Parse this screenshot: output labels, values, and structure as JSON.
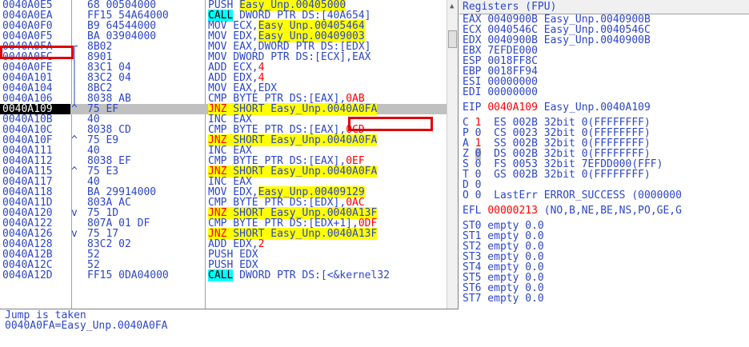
{
  "disasm": {
    "rows": [
      {
        "addr": "0040A0E5",
        "arrow": "",
        "hex": "68 00504000",
        "cmd": [
          {
            "t": "PUSH ",
            "s": ""
          },
          {
            "t": "Easy_Unp.00405000",
            "s": "hl"
          }
        ]
      },
      {
        "addr": "0040A0EA",
        "arrow": "",
        "hex": "FF15 54A64000",
        "cmd": [
          {
            "t": "CALL",
            "s": "call"
          },
          {
            "t": " DWORD PTR DS:[40A654]",
            "s": ""
          }
        ]
      },
      {
        "addr": "0040A0F0",
        "arrow": "",
        "hex": "B9 64544000",
        "cmd": [
          {
            "t": "MOV ECX,",
            "s": ""
          },
          {
            "t": "Easy_Unp.00405464",
            "s": "hl"
          }
        ]
      },
      {
        "addr": "0040A0F5",
        "arrow": "",
        "hex": "BA 03904000",
        "cmd": [
          {
            "t": "MOV EDX,",
            "s": ""
          },
          {
            "t": "Easy_Unp.00409003",
            "s": "hl"
          }
        ]
      },
      {
        "addr": "0040A0FA",
        "arrow": "┌",
        "hex": "8B02",
        "cmd": [
          {
            "t": "MOV EAX,DWORD PTR DS:[EDX]",
            "s": ""
          }
        ]
      },
      {
        "addr": "0040A0FC",
        "arrow": "│",
        "hex": "8901",
        "cmd": [
          {
            "t": "MOV DWORD PTR DS:[ECX],EAX",
            "s": ""
          }
        ]
      },
      {
        "addr": "0040A0FE",
        "arrow": "│",
        "hex": "83C1 04",
        "cmd": [
          {
            "t": "ADD ECX,",
            "s": ""
          },
          {
            "t": "4",
            "s": "red"
          }
        ]
      },
      {
        "addr": "0040A101",
        "arrow": "│",
        "hex": "83C2 04",
        "cmd": [
          {
            "t": "ADD EDX,",
            "s": ""
          },
          {
            "t": "4",
            "s": "red"
          }
        ]
      },
      {
        "addr": "0040A104",
        "arrow": "│",
        "hex": "8BC2",
        "cmd": [
          {
            "t": "MOV EAX,EDX",
            "s": ""
          }
        ]
      },
      {
        "addr": "0040A106",
        "arrow": "│",
        "hex": "8038 AB",
        "cmd": [
          {
            "t": "CMP BYTE PTR DS:[EAX],",
            "s": ""
          },
          {
            "t": "0AB",
            "s": "red"
          }
        ]
      },
      {
        "addr": "0040A109",
        "arrow": "^",
        "hex": "75 EF",
        "cmd": [
          {
            "t": "JNZ",
            "s": "jnz"
          },
          {
            "t": " SHORT Easy_Unp.0040A0FA",
            "s": "hl"
          }
        ],
        "sel": true
      },
      {
        "addr": "0040A10B",
        "arrow": "",
        "hex": "40",
        "cmd": [
          {
            "t": "INC EAX",
            "s": ""
          }
        ]
      },
      {
        "addr": "0040A10C",
        "arrow": "",
        "hex": "8038 CD",
        "cmd": [
          {
            "t": "CMP BYTE PTR DS:[EAX],",
            "s": ""
          },
          {
            "t": "0CD",
            "s": "red"
          }
        ]
      },
      {
        "addr": "0040A10F",
        "arrow": "^",
        "hex": "75 E9",
        "cmd": [
          {
            "t": "JNZ",
            "s": "jnz"
          },
          {
            "t": " SHORT Easy_Unp.0040A0FA",
            "s": "hl"
          }
        ]
      },
      {
        "addr": "0040A111",
        "arrow": "",
        "hex": "40",
        "cmd": [
          {
            "t": "INC EAX",
            "s": ""
          }
        ]
      },
      {
        "addr": "0040A112",
        "arrow": "",
        "hex": "8038 EF",
        "cmd": [
          {
            "t": "CMP BYTE PTR DS:[EAX],",
            "s": ""
          },
          {
            "t": "0EF",
            "s": "red"
          }
        ]
      },
      {
        "addr": "0040A115",
        "arrow": "^",
        "hex": "75 E3",
        "cmd": [
          {
            "t": "JNZ",
            "s": "jnz"
          },
          {
            "t": " SHORT Easy_Unp.0040A0FA",
            "s": "hl"
          }
        ]
      },
      {
        "addr": "0040A117",
        "arrow": "",
        "hex": "40",
        "cmd": [
          {
            "t": "INC EAX",
            "s": ""
          }
        ]
      },
      {
        "addr": "0040A118",
        "arrow": "",
        "hex": "BA 29914000",
        "cmd": [
          {
            "t": "MOV EDX,",
            "s": ""
          },
          {
            "t": "Easy_Unp.00409129",
            "s": "hl"
          }
        ]
      },
      {
        "addr": "0040A11D",
        "arrow": "",
        "hex": "803A AC",
        "cmd": [
          {
            "t": "CMP BYTE PTR DS:[EDX],",
            "s": ""
          },
          {
            "t": "0AC",
            "s": "red"
          }
        ]
      },
      {
        "addr": "0040A120",
        "arrow": "v",
        "hex": "75 1D",
        "cmd": [
          {
            "t": "JNZ",
            "s": "jnz"
          },
          {
            "t": " SHORT Easy_Unp.0040A13F",
            "s": "hl"
          }
        ]
      },
      {
        "addr": "0040A122",
        "arrow": "",
        "hex": "807A 01 DF",
        "cmd": [
          {
            "t": "CMP BYTE PTR DS:[EDX+1],",
            "s": ""
          },
          {
            "t": "0DF",
            "s": "red"
          }
        ]
      },
      {
        "addr": "0040A126",
        "arrow": "v",
        "hex": "75 17",
        "cmd": [
          {
            "t": "JNZ",
            "s": "jnz"
          },
          {
            "t": " SHORT Easy_Unp.0040A13F",
            "s": "hl"
          }
        ]
      },
      {
        "addr": "0040A128",
        "arrow": "",
        "hex": "83C2 02",
        "cmd": [
          {
            "t": "ADD EDX,",
            "s": ""
          },
          {
            "t": "2",
            "s": "red"
          }
        ]
      },
      {
        "addr": "0040A12B",
        "arrow": "",
        "hex": "52",
        "cmd": [
          {
            "t": "PUSH EDX",
            "s": ""
          }
        ]
      },
      {
        "addr": "0040A12C",
        "arrow": "",
        "hex": "52",
        "cmd": [
          {
            "t": "PUSH EDX",
            "s": ""
          }
        ]
      },
      {
        "addr": "0040A12D",
        "arrow": "",
        "hex": "FF15 0DA04000",
        "cmd": [
          {
            "t": "CALL",
            "s": "call"
          },
          {
            "t": " DWORD PTR DS:[<&kernel32",
            "s": ""
          }
        ]
      }
    ]
  },
  "info": {
    "line1": "Jump is taken",
    "line2": "0040A0FA=Easy_Unp.0040A0FA"
  },
  "registers": {
    "title": "Registers (FPU)",
    "gp": [
      {
        "name": "EAX",
        "value": "0040900B",
        "comment": "Easy_Unp.0040900B"
      },
      {
        "name": "ECX",
        "value": "0040546C",
        "comment": "Easy_Unp.0040546C"
      },
      {
        "name": "EDX",
        "value": "0040900B",
        "comment": "Easy_Unp.0040900B"
      },
      {
        "name": "EBX",
        "value": "7EFDE000",
        "comment": ""
      },
      {
        "name": "ESP",
        "value": "0018FF8C",
        "comment": ""
      },
      {
        "name": "EBP",
        "value": "0018FF94",
        "comment": ""
      },
      {
        "name": "ESI",
        "value": "00000000",
        "comment": ""
      },
      {
        "name": "EDI",
        "value": "00000000",
        "comment": ""
      }
    ],
    "eip": {
      "name": "EIP",
      "value": "0040A109",
      "comment": "Easy_Unp.0040A109"
    },
    "flags": [
      {
        "f": "C",
        "v": "1",
        "seg": "ES 002B 32bit 0(FFFFFFFF)",
        "red": true
      },
      {
        "f": "P",
        "v": "0",
        "seg": "CS 0023 32bit 0(FFFFFFFF)",
        "red": false
      },
      {
        "f": "A",
        "v": "1",
        "seg": "SS 002B 32bit 0(FFFFFFFF)",
        "red": true
      },
      {
        "f": "Z",
        "v": "0",
        "seg": "DS 002B 32bit 0(FFFFFFFF)",
        "red": false,
        "box": true
      },
      {
        "f": "S",
        "v": "0",
        "seg": "FS 0053 32bit 7EFDD000(FFF)",
        "red": false
      },
      {
        "f": "T",
        "v": "0",
        "seg": "GS 002B 32bit 0(FFFFFFFF)",
        "red": false
      },
      {
        "f": "D",
        "v": "0",
        "seg": "",
        "red": false
      },
      {
        "f": "O",
        "v": "0",
        "seg": "LastErr ERROR_SUCCESS (0000000",
        "red": false
      }
    ],
    "efl": {
      "name": "EFL",
      "value": "00000213",
      "comment": "(NO,B,NE,BE,NS,PO,GE,G"
    },
    "fpu": [
      "ST0 empty 0.0",
      "ST1 empty 0.0",
      "ST2 empty 0.0",
      "ST3 empty 0.0",
      "ST4 empty 0.0",
      "ST5 empty 0.0",
      "ST6 empty 0.0",
      "ST7 empty 0.0"
    ]
  }
}
